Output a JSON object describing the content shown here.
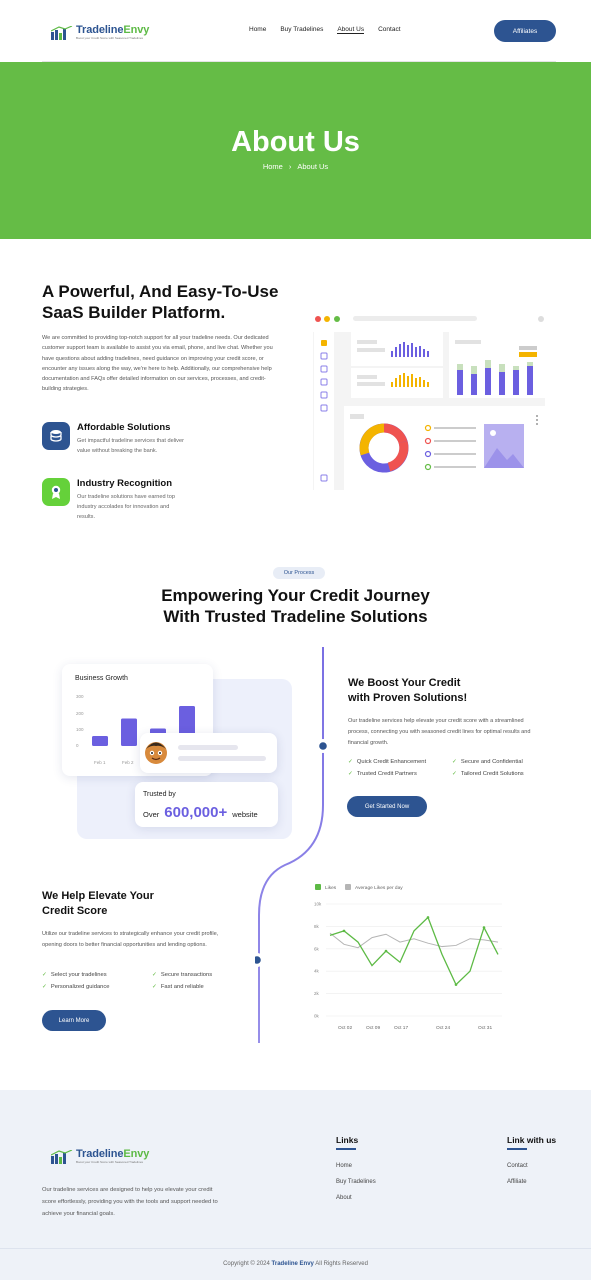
{
  "header": {
    "logo": {
      "name_part1": "Tradeline",
      "name_part2": "Envy",
      "tagline": "Boost your Credit Score with Seasoned Tradelines"
    },
    "nav": [
      "Home",
      "Buy Tradelines",
      "About Us",
      "Contact"
    ],
    "active_nav": "About Us",
    "cta_label": "Affiliates"
  },
  "hero": {
    "title": "About Us",
    "crumb_home": "Home",
    "crumb_sep": "›",
    "crumb_current": "About Us"
  },
  "about": {
    "title": "A Powerful, And Easy-To-Use SaaS Builder Platform.",
    "paragraph": "We are committed to providing top-notch support for all your tradeline needs. Our dedicated customer support team is available to assist you via email, phone, and live chat. Whether you have questions about adding tradelines, need guidance on improving your credit score, or encounter any issues along the way, we're here to help. Additionally, our comprehensive help documentation and FAQs offer detailed information on our services, processes, and credit-building strategies.",
    "features": [
      {
        "icon": "coins-icon",
        "title": "Affordable Solutions",
        "desc": "Get impactful tradeline services that deliver value without breaking the bank."
      },
      {
        "icon": "award-icon",
        "title": "Industry Recognition",
        "desc": "Our tradeline solutions have earned top industry accolades for innovation and results."
      }
    ]
  },
  "process": {
    "pill": "Our Process",
    "title_line1": "Empowering Your Credit Journey",
    "title_line2": "With Trusted Tradeline Solutions",
    "growth_card": {
      "title": "Business Growth",
      "y_ticks": [
        "300",
        "200",
        "100",
        "0"
      ],
      "x_ticks": [
        "Feb 1",
        "Feb 2"
      ],
      "bars": [
        0.2,
        0.55,
        0.35,
        0.8
      ]
    },
    "trust": {
      "by": "Trusted by",
      "over": "Over",
      "number": "600,000+",
      "suffix": "website"
    },
    "boost": {
      "title_line1": "We Boost Your Credit",
      "title_line2": "with Proven Solutions!",
      "paragraph": "Our tradeline services help elevate your credit score with a streamlined process, connecting you with seasoned credit lines for optimal results and financial growth.",
      "checks": [
        "Quick Credit Enhancement",
        "Secure and Confidential",
        "Trusted Credit Partners",
        "Tailored Credit Solutions"
      ],
      "button": "Get Started Now"
    },
    "elevate": {
      "title_line1": "We Help Elevate Your",
      "title_line2": "Credit Score",
      "paragraph": "Utilize our tradeline services to strategically enhance your credit profile, opening doors to better financial opportunities and lending options.",
      "checks": [
        "Select your tradelines",
        "Secure transactions",
        "Personalized guidance",
        "Fast and reliable"
      ],
      "button": "Learn More"
    }
  },
  "chart_data": {
    "type": "line",
    "title": "",
    "xlabel": "",
    "ylabel": "",
    "x_ticks": [
      "Oct 02",
      "Oct 09",
      "Oct 17",
      "Oct 24",
      "Oct 31"
    ],
    "y_ticks": [
      "0k",
      "2k",
      "4k",
      "6k",
      "8k",
      "10k"
    ],
    "ylim": [
      0,
      10000
    ],
    "x_points": [
      0,
      1,
      2,
      3,
      4,
      5,
      6,
      7,
      8,
      9,
      10,
      11
    ],
    "series": [
      {
        "name": "Likes",
        "color": "#5dba45",
        "values": [
          7200,
          7600,
          6600,
          4500,
          5800,
          4800,
          7600,
          8800,
          5500,
          2800,
          4000,
          7900,
          5500
        ]
      },
      {
        "name": "Average Likes per day",
        "color": "#b5b5b5",
        "values": [
          7400,
          6400,
          6100,
          7000,
          7300,
          6600,
          6900,
          6500,
          6200,
          6300,
          6900,
          6800,
          6600
        ]
      }
    ],
    "legend_position": "top-left",
    "grid": true
  },
  "footer": {
    "paragraph": "Our tradeline services are designed to help you elevate your credit score effortlessly, providing you with the tools and support needed to achieve your financial goals.",
    "links_title": "Links",
    "links": [
      "Home",
      "Buy Tradelines",
      "About"
    ],
    "link_with_us_title": "Link with us",
    "link_with_us": [
      "Contact",
      "Affiliate"
    ],
    "copyright_pre": "Copyright © 2024",
    "copyright_brand": "Tradeline Envy",
    "copyright_post": "All Rights Reserved"
  }
}
